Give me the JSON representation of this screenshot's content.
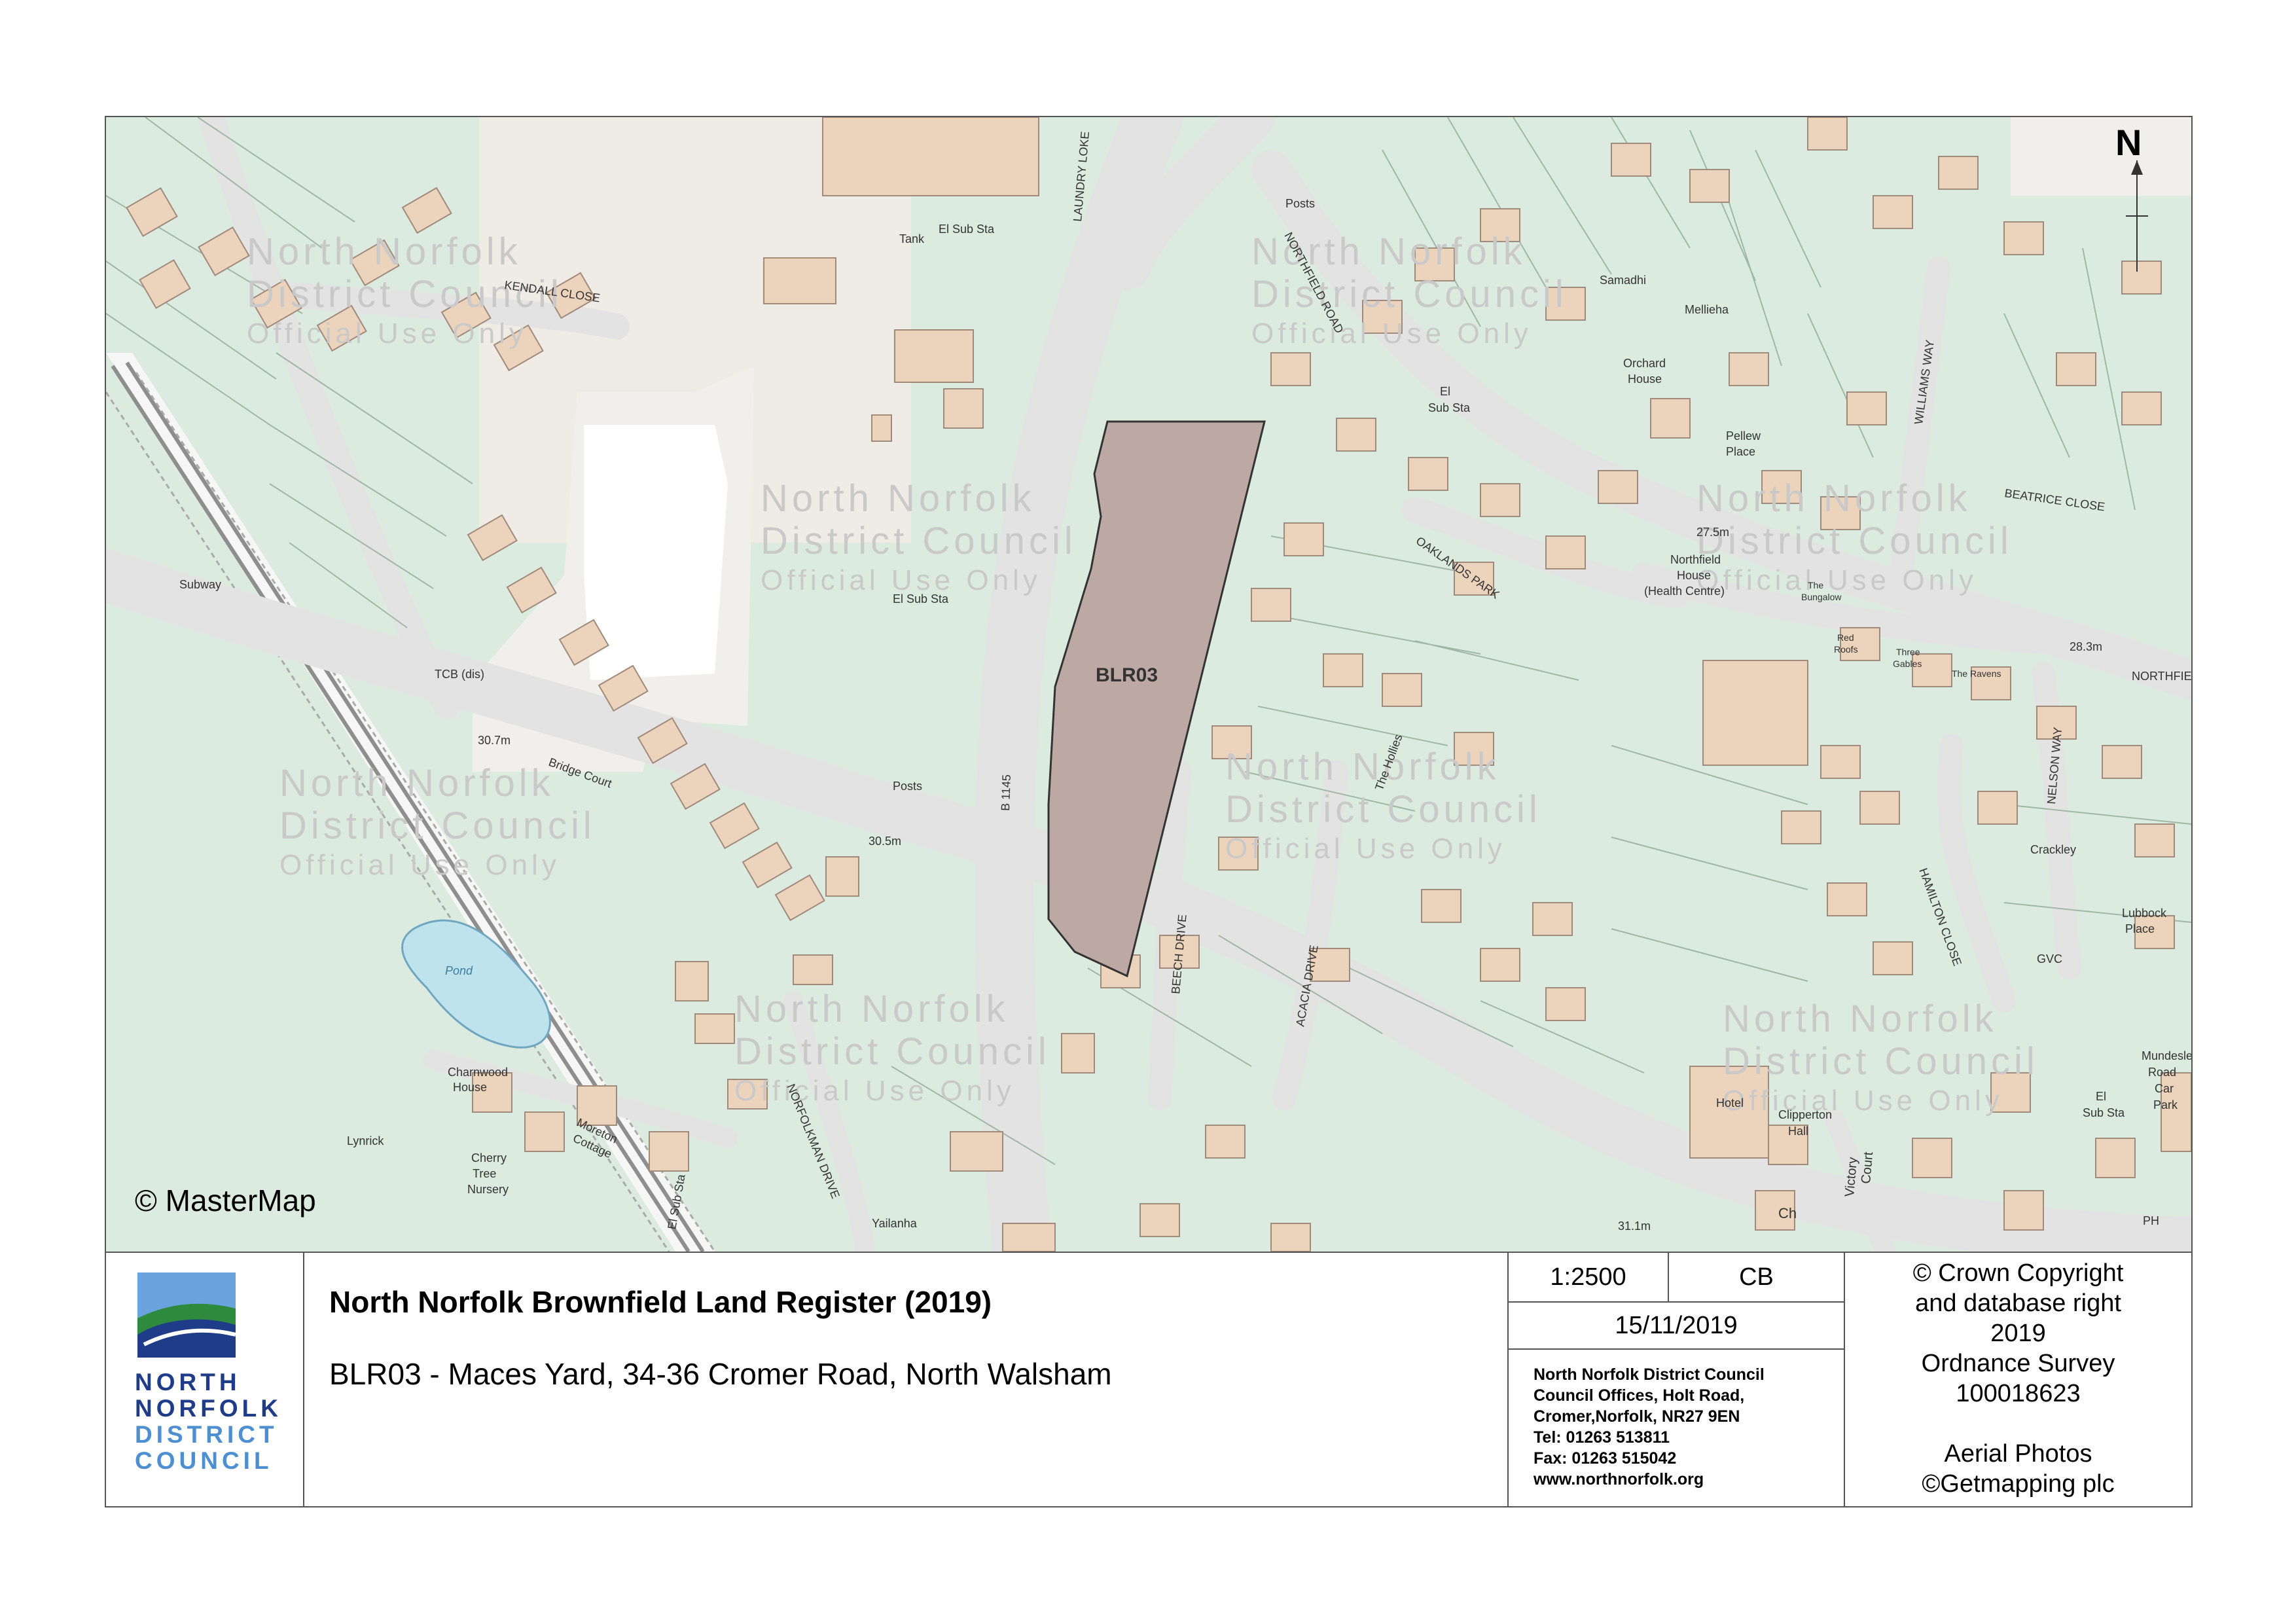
{
  "map": {
    "site_label": "BLR03",
    "copyright": "© MasterMap",
    "north_arrow": "N",
    "watermark": [
      "North Norfolk",
      "District Council",
      "Official Use Only"
    ],
    "place_labels": {
      "posts_1": "Posts",
      "tank": "Tank",
      "el_sub_sta_1": "El Sub Sta",
      "kendall_close": "KENDALL CLOSE",
      "laundry_loke": "LAUNDRY LOKE",
      "northfield_road": "NORTHFIELD ROAD",
      "samadhi": "Samadhi",
      "mellieha": "Mellieha",
      "orchard_house": [
        "Orchard",
        "House"
      ],
      "el_sub_sta_2": [
        "El",
        "Sub Sta"
      ],
      "williams_way": "WILLIAMS WAY",
      "pellew_place": [
        "Pellew",
        "Place"
      ],
      "beatrice_close": "BEATRICE CLOSE",
      "height_275": "27.5m",
      "northfield_house": [
        "Northfield",
        "House",
        "(Health Centre)"
      ],
      "the_bungalow": [
        "The",
        "Bungalow"
      ],
      "red_roofs": [
        "Red",
        "Roofs"
      ],
      "three_gables": [
        "Three",
        "Gables"
      ],
      "the_ravens": "The Ravens",
      "height_283": "28.3m",
      "northfield": "NORTHFIELD",
      "subway": "Subway",
      "el_sub_sta_3": "El Sub Sta",
      "tcb": "TCB (dis)",
      "height_307": "30.7m",
      "bridge_court": "Bridge Court",
      "b1145": "B 1145",
      "oaklands_park": "OAKLANDS PARK",
      "the_hollies": "The Hollies",
      "beech_drive": "BEECH DRIVE",
      "acacia_drive": "ACACIA DRIVE",
      "posts_2": "Posts",
      "height_305": "30.5m",
      "pond": "Pond",
      "charnwood_house": [
        "Charnwood",
        "House"
      ],
      "moreton_cottage": [
        "Moreton",
        "Cottage"
      ],
      "lynrick": "Lynrick",
      "cherry_tree_nursery": [
        "Cherry",
        "Tree",
        "Nursery"
      ],
      "norfolkman_drive": "NORFOLKMAN DRIVE",
      "yailanha": "Yailanha",
      "el_sub_sta_4": "El Sub Sta",
      "hotel": "Hotel",
      "clipperton_hall": [
        "Clipperton",
        "Hall"
      ],
      "victory_court": [
        "Victory",
        "Court"
      ],
      "hamilton_close": "HAMILTON CLOSE",
      "nelson_way": "NELSON WAY",
      "crackley": "Crackley",
      "lubbock_place": [
        "Lubbock",
        "Place"
      ],
      "gvc": "GVC",
      "mundesley_car_park": [
        "Mundesley",
        "Road",
        "Car",
        "Park"
      ],
      "el_sub_sta_5": [
        "El",
        "Sub Sta"
      ],
      "height_311": "31.1m",
      "ch": "Ch",
      "ph": "PH"
    }
  },
  "footer": {
    "logo_lines": [
      "NORTH",
      "NORFOLK",
      "DISTRICT",
      "COUNCIL"
    ],
    "title": "North Norfolk Brownfield Land Register (2019)",
    "subtitle": "BLR03 - Maces Yard, 34-36 Cromer Road, North Walsham",
    "scale": "1:2500",
    "initials": "CB",
    "date": "15/11/2019",
    "address_lines": [
      "North Norfolk District Council",
      "Council Offices, Holt Road,",
      "Cromer,Norfolk, NR27 9EN",
      "Tel: 01263 513811",
      "Fax: 01263 515042",
      "www.northnorfolk.org"
    ],
    "rights_lines": [
      "© Crown Copyright",
      "and database right",
      "2019",
      "Ordnance Survey",
      "100018623",
      "",
      "Aerial Photos",
      "©Getmapping plc"
    ]
  },
  "colors": {
    "map_background": "#dcebdf",
    "road": "#e3e3e3",
    "building": "#ecd3bb",
    "building_stroke": "#a08a7a",
    "site_fill": "#bda9a3",
    "water": "#bfe3ec",
    "rail": "#8e8e8e",
    "logo_blue": "#1f3c88",
    "logo_sky": "#6aa3dd",
    "logo_green": "#2e8b3e"
  }
}
